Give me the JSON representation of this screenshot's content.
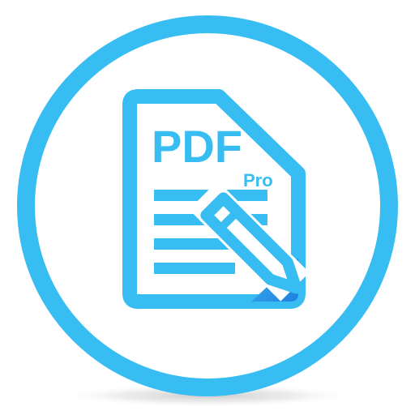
{
  "icon": {
    "name": "pdf-pro-app-icon",
    "primary_text": "PDF",
    "badge_text": "Pro",
    "colors": {
      "accent": "#37bdf2",
      "accent_dark": "#2397e8",
      "background": "#ffffff",
      "shadow": "#c8c8c8"
    }
  }
}
